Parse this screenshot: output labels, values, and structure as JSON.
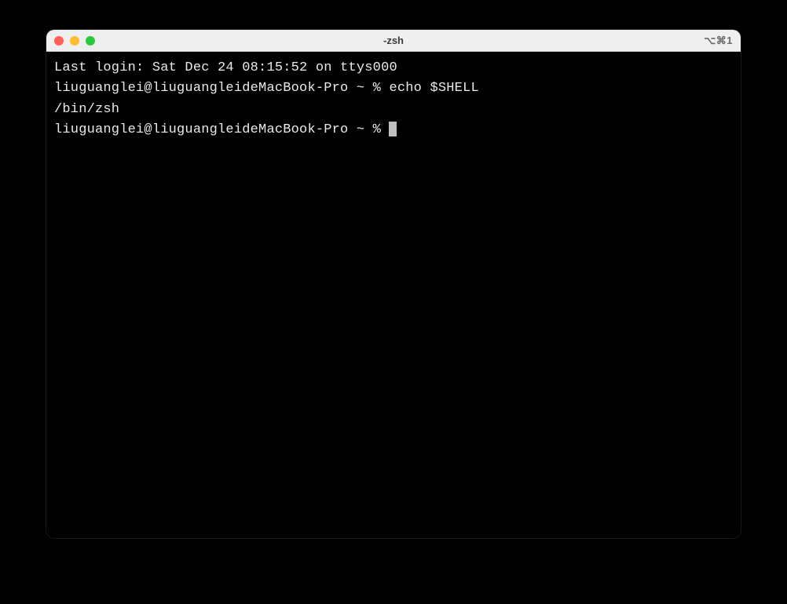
{
  "titlebar": {
    "title": "-zsh",
    "shortcut": "⌥⌘1"
  },
  "terminal": {
    "line1": "Last login: Sat Dec 24 08:15:52 on ttys000",
    "line2_prompt": "liuguanglei@liuguangleideMacBook-Pro ~ % ",
    "line2_cmd": "echo $SHELL",
    "line3": "/bin/zsh",
    "line4_prompt": "liuguanglei@liuguangleideMacBook-Pro ~ % "
  }
}
